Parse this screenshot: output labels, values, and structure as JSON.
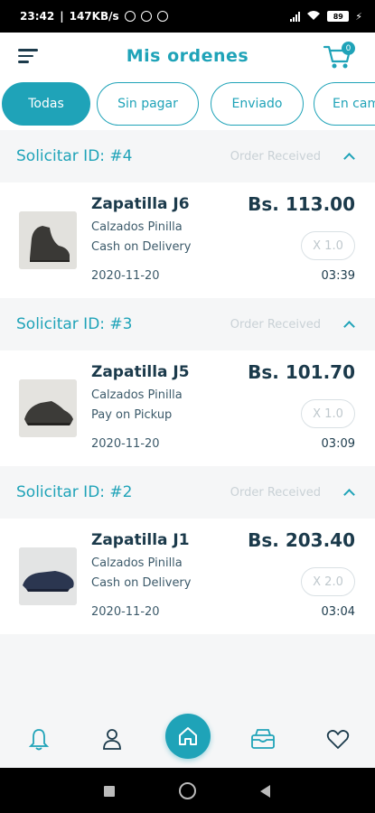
{
  "statusbar": {
    "time": "23:42",
    "speed": "147KB/s",
    "battery": "89"
  },
  "appbar": {
    "title": "Mis ordenes",
    "cart_count": "0"
  },
  "tabs": [
    {
      "label": "Todas"
    },
    {
      "label": "Sin pagar"
    },
    {
      "label": "Enviado"
    },
    {
      "label": "En camino"
    }
  ],
  "orders": [
    {
      "id_label": "Solicitar ID: #4",
      "status": "Order Received",
      "product": "Zapatilla J6",
      "store": "Calzados Pinilla",
      "payment": "Cash on Delivery",
      "price": "Bs. 113.00",
      "qty": "X 1.0",
      "date": "2020-11-20",
      "time": "03:39"
    },
    {
      "id_label": "Solicitar ID: #3",
      "status": "Order Received",
      "product": "Zapatilla J5",
      "store": "Calzados Pinilla",
      "payment": "Pay on Pickup",
      "price": "Bs. 101.70",
      "qty": "X 1.0",
      "date": "2020-11-20",
      "time": "03:09"
    },
    {
      "id_label": "Solicitar ID: #2",
      "status": "Order Received",
      "product": "Zapatilla J1",
      "store": "Calzados Pinilla",
      "payment": "Cash on Delivery",
      "price": "Bs. 203.40",
      "qty": "X 2.0",
      "date": "2020-11-20",
      "time": "03:04"
    }
  ],
  "bottomnav": [
    "bell-icon",
    "user-icon",
    "home-icon",
    "inbox-icon",
    "heart-icon"
  ],
  "colors": {
    "accent": "#1fa3b8",
    "text_dark": "#1b3a4b",
    "muted": "#c9d1d6"
  }
}
